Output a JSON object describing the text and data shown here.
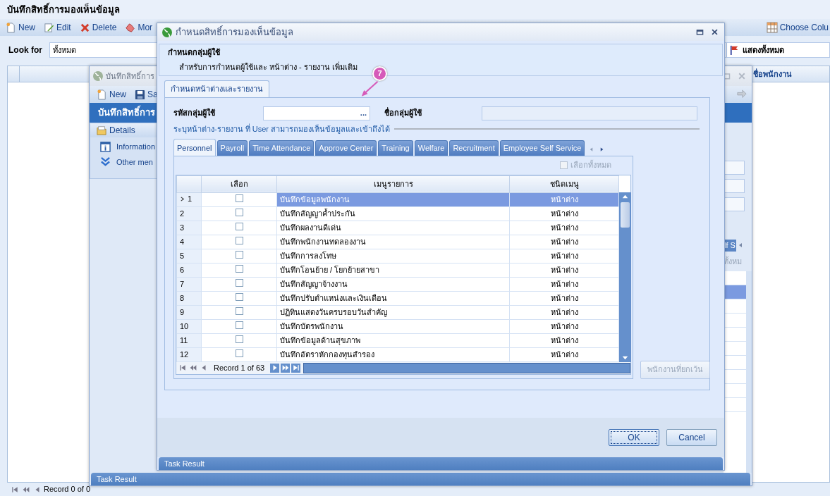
{
  "app": {
    "title": "บันทึกสิทธิ์การมองเห็นข้อมูล",
    "toolbar": [
      {
        "kind": "new",
        "label": "New"
      },
      {
        "kind": "edit",
        "label": "Edit"
      },
      {
        "kind": "delete",
        "label": "Delete"
      },
      {
        "kind": "move",
        "label": "Mor"
      }
    ],
    "choose_columns": "Choose Colu",
    "look_for": {
      "label": "Look for",
      "value": "ทั้งหมด"
    },
    "show_all": "แสดงทั้งหมด",
    "grid": {
      "column": "ชื่อพนักงาน"
    },
    "pager": "Record 0 of 0"
  },
  "record_window": {
    "title": "บันทึกสิทธิ์การ",
    "toolbar": [
      {
        "kind": "new",
        "label": "New"
      },
      {
        "kind": "save",
        "label": "Sa"
      }
    ],
    "header": "บันทึกสิทธิ์การ",
    "details": {
      "title": "Details",
      "links": [
        {
          "kind": "info",
          "label": "Information"
        },
        {
          "kind": "more",
          "label": "Other men"
        }
      ]
    },
    "tab_fragment": "lf S",
    "select_all_fragment": "ทั้งหม",
    "task_result": "Task Result"
  },
  "dialog": {
    "title": "กำหนดสิทธิ์การมองเห็นข้อมูล",
    "group": {
      "title": "กำหนดกลุ่มผู้ใช้",
      "subtitle": "สำหรับการกำหนดผู้ใช้และ หน้าต่าง - รายงาน เพิ่มเติม"
    },
    "tab": {
      "label": "กำหนดหน้าต่างและรายงาน",
      "selected": true
    },
    "group_code": {
      "label": "รหัสกลุ่มผู้ใช้",
      "button": "..."
    },
    "group_name": {
      "label": "ชื่อกลุ่มผู้ใช้"
    },
    "note": "ระบุหน้าต่าง-รายงาน ที่ User สามารถมองเห็นข้อมูลและเข้าถึงได้",
    "module_tabs": [
      {
        "label": "Personnel",
        "selected": true
      },
      {
        "label": "Payroll",
        "selected": false
      },
      {
        "label": "Time Attendance",
        "selected": false
      },
      {
        "label": "Approve Center",
        "selected": false
      },
      {
        "label": "Training",
        "selected": false
      },
      {
        "label": "Welfare",
        "selected": false
      },
      {
        "label": "Recruitment",
        "selected": false
      },
      {
        "label": "Employee Self Service",
        "selected": false
      }
    ],
    "select_all": {
      "label": "เลือกทั้งหมด",
      "checked": false,
      "disabled": true
    },
    "grid": {
      "columns": [
        "เลือก",
        "เมนูรายการ",
        "ชนิดเมนู"
      ],
      "rows": [
        {
          "number": "1",
          "checked": false,
          "menu": "บันทึกข้อมูลพนักงาน",
          "type": "หน้าต่าง",
          "selected": true
        },
        {
          "number": "2",
          "checked": false,
          "menu": "บันทึกสัญญาค้ำประกัน",
          "type": "หน้าต่าง",
          "selected": false
        },
        {
          "number": "3",
          "checked": false,
          "menu": "บันทึกผลงานดีเด่น",
          "type": "หน้าต่าง",
          "selected": false
        },
        {
          "number": "4",
          "checked": false,
          "menu": "บันทึกพนักงานทดลองงาน",
          "type": "หน้าต่าง",
          "selected": false
        },
        {
          "number": "5",
          "checked": false,
          "menu": "บันทึกการลงโทษ",
          "type": "หน้าต่าง",
          "selected": false
        },
        {
          "number": "6",
          "checked": false,
          "menu": "บันทึกโอนย้าย / โยกย้ายสาขา",
          "type": "หน้าต่าง",
          "selected": false
        },
        {
          "number": "7",
          "checked": false,
          "menu": "บันทึกสัญญาจ้างงาน",
          "type": "หน้าต่าง",
          "selected": false
        },
        {
          "number": "8",
          "checked": false,
          "menu": "บันทึกปรับตำแหน่งและเงินเดือน",
          "type": "หน้าต่าง",
          "selected": false
        },
        {
          "number": "9",
          "checked": false,
          "menu": "ปฏิทินแสดงวันครบรอบวันสำคัญ",
          "type": "หน้าต่าง",
          "selected": false
        },
        {
          "number": "10",
          "checked": false,
          "menu": "บันทึกบัตรพนักงาน",
          "type": "หน้าต่าง",
          "selected": false
        },
        {
          "number": "11",
          "checked": false,
          "menu": "บันทึกข้อมูลด้านสุขภาพ",
          "type": "หน้าต่าง",
          "selected": false
        },
        {
          "number": "12",
          "checked": false,
          "menu": "บันทึกอัตราหักกองทุนสำรอง",
          "type": "หน้าต่าง",
          "selected": false
        }
      ]
    },
    "pager": "Record 1 of 63",
    "exception_button": {
      "label": "พนักงานที่ยกเว้น",
      "disabled": true
    },
    "buttons": [
      {
        "label": "OK",
        "default": true
      },
      {
        "label": "Cancel",
        "default": false
      }
    ],
    "task_result": "Task Result",
    "callout": "7"
  }
}
